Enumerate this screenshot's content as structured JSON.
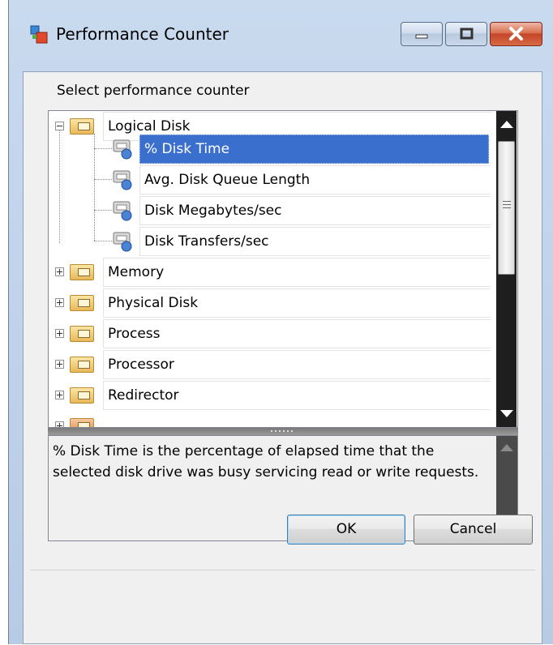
{
  "window": {
    "title": "Performance Counter"
  },
  "dialog": {
    "prompt": "Select performance counter",
    "tree": [
      {
        "label": "Logical Disk",
        "type": "category",
        "expanded": true,
        "children": [
          {
            "label": "% Disk Time",
            "selected": true
          },
          {
            "label": "Avg. Disk Queue Length"
          },
          {
            "label": "Disk Megabytes/sec"
          },
          {
            "label": "Disk Transfers/sec"
          }
        ]
      },
      {
        "label": "Memory",
        "type": "category",
        "expanded": false
      },
      {
        "label": "Physical Disk",
        "type": "category",
        "expanded": false
      },
      {
        "label": "Process",
        "type": "category",
        "expanded": false
      },
      {
        "label": "Processor",
        "type": "category",
        "expanded": false
      },
      {
        "label": "Redirector",
        "type": "category",
        "expanded": false
      }
    ],
    "description": "% Disk Time is the percentage of elapsed time that the selected disk drive was busy servicing read or write requests.",
    "buttons": {
      "ok": "OK",
      "cancel": "Cancel"
    }
  },
  "icons": {
    "app": "performance-counter-icon",
    "category": "folder-icon",
    "counter": "counter-icon"
  },
  "colors": {
    "selection": "#3b6fce",
    "scrollbar": "#1e1e1e",
    "close_button": "#c4462a"
  }
}
